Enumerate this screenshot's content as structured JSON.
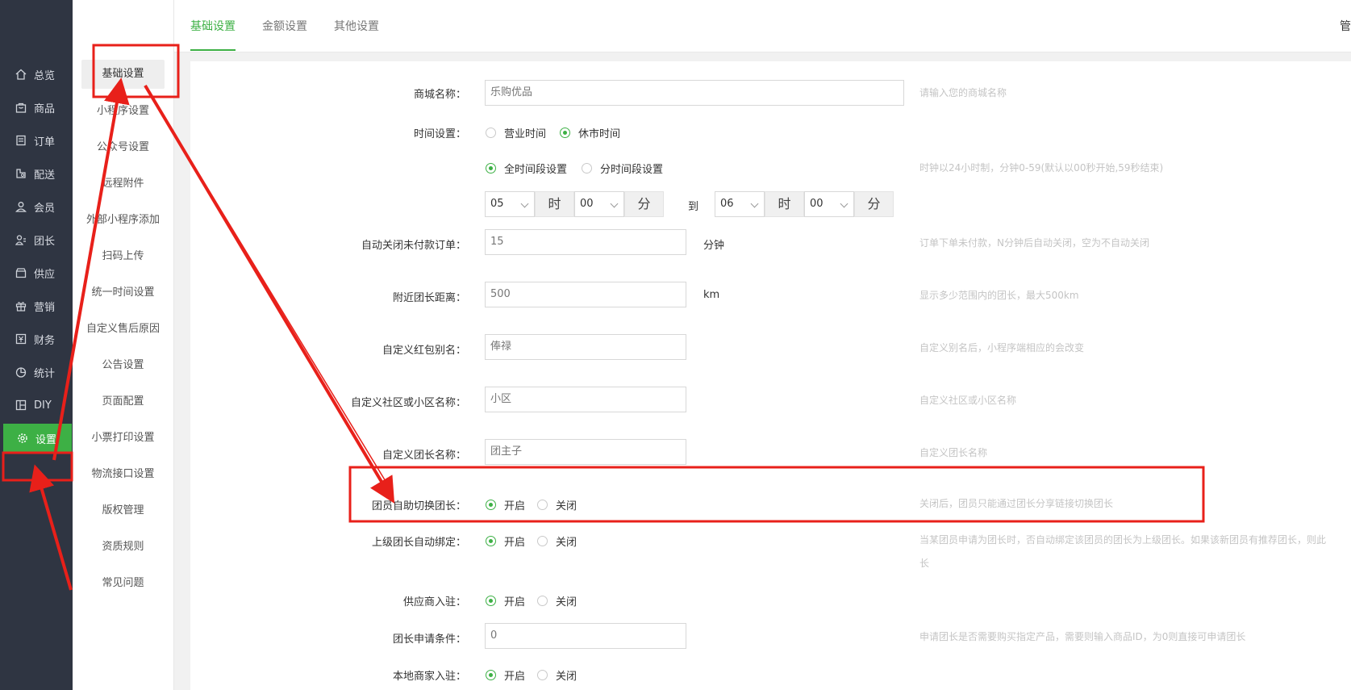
{
  "nav": {
    "items": [
      {
        "label": "总览",
        "icon": "home-icon"
      },
      {
        "label": "商品",
        "icon": "shopping-bag-icon"
      },
      {
        "label": "订单",
        "icon": "order-list-icon"
      },
      {
        "label": "配送",
        "icon": "delivery-icon"
      },
      {
        "label": "会员",
        "icon": "user-icon"
      },
      {
        "label": "团长",
        "icon": "leader-icon"
      },
      {
        "label": "供应",
        "icon": "supply-store-icon"
      },
      {
        "label": "营销",
        "icon": "gift-icon"
      },
      {
        "label": "财务",
        "icon": "finance-icon"
      },
      {
        "label": "统计",
        "icon": "pie-chart-icon"
      },
      {
        "label": "DIY",
        "icon": "layout-icon"
      },
      {
        "label": "设置",
        "icon": "gear-icon"
      }
    ],
    "active": "设置"
  },
  "submenu": {
    "items": [
      "基础设置",
      "小程序设置",
      "公众号设置",
      "远程附件",
      "外部小程序添加",
      "扫码上传",
      "统一时间设置",
      "自定义售后原因",
      "公告设置",
      "页面配置",
      "小票打印设置",
      "物流接口设置",
      "版权管理",
      "资质规则",
      "常见问题"
    ],
    "active": "基础设置"
  },
  "tabs": {
    "items": [
      "基础设置",
      "金额设置",
      "其他设置"
    ],
    "active": "基础设置",
    "corner": "管"
  },
  "form": {
    "shop_name": {
      "label": "商城名称：",
      "value": "乐购优品",
      "hint": "请输入您的商城名称"
    },
    "time_setting": {
      "label": "时间设置：",
      "options": [
        "营业时间",
        "休市时间"
      ],
      "selected": "休市时间"
    },
    "time_mode": {
      "options": [
        "全时间段设置",
        "分时间段设置"
      ],
      "selected": "全时间段设置",
      "hint": "时钟以24小时制，分钟0-59(默认以00秒开始,59秒结束)"
    },
    "time_range": {
      "start_hour": "05",
      "start_min": "00",
      "end_hour": "06",
      "end_min": "00",
      "hour_unit": "时",
      "min_unit": "分",
      "to": "到"
    },
    "auto_close": {
      "label": "自动关闭未付款订单：",
      "value": "15",
      "unit": "分钟",
      "hint": "订单下单未付款，N分钟后自动关闭，空为不自动关闭"
    },
    "nearby_distance": {
      "label": "附近团长距离：",
      "value": "500",
      "unit": "km",
      "hint": "显示多少范围内的团长，最大500km"
    },
    "red_packet_alias": {
      "label": "自定义红包别名：",
      "value": "俸禄",
      "hint": "自定义别名后，小程序端相应的会改变"
    },
    "community_name": {
      "label": "自定义社区或小区名称：",
      "value": "小区",
      "hint": "自定义社区或小区名称"
    },
    "leader_name": {
      "label": "自定义团长名称：",
      "value": "团主子",
      "hint": "自定义团长名称"
    },
    "member_switch_leader": {
      "label": "团员自助切换团长：",
      "options": [
        "开启",
        "关闭"
      ],
      "selected": "开启",
      "hint": "关闭后，团员只能通过团长分享链接切换团长"
    },
    "auto_bind_leader": {
      "label": "上级团长自动绑定：",
      "options": [
        "开启",
        "关闭"
      ],
      "selected": "开启",
      "hint": "当某团员申请为团长时，否自动绑定该团员的团长为上级团长。如果该新团员有推荐团长，则此",
      "hint2": "长"
    },
    "supplier_join": {
      "label": "供应商入驻：",
      "options": [
        "开启",
        "关闭"
      ],
      "selected": "开启"
    },
    "leader_apply": {
      "label": "团长申请条件：",
      "value": "0",
      "hint": "申请团长是否需要购买指定产品，需要则输入商品ID，为0则直接可申请团长"
    },
    "local_merchant": {
      "label": "本地商家入驻：",
      "options": [
        "开启",
        "关闭"
      ],
      "selected": "开启"
    }
  },
  "annotation_color": "#e8201a",
  "accent_color": "#3db045"
}
